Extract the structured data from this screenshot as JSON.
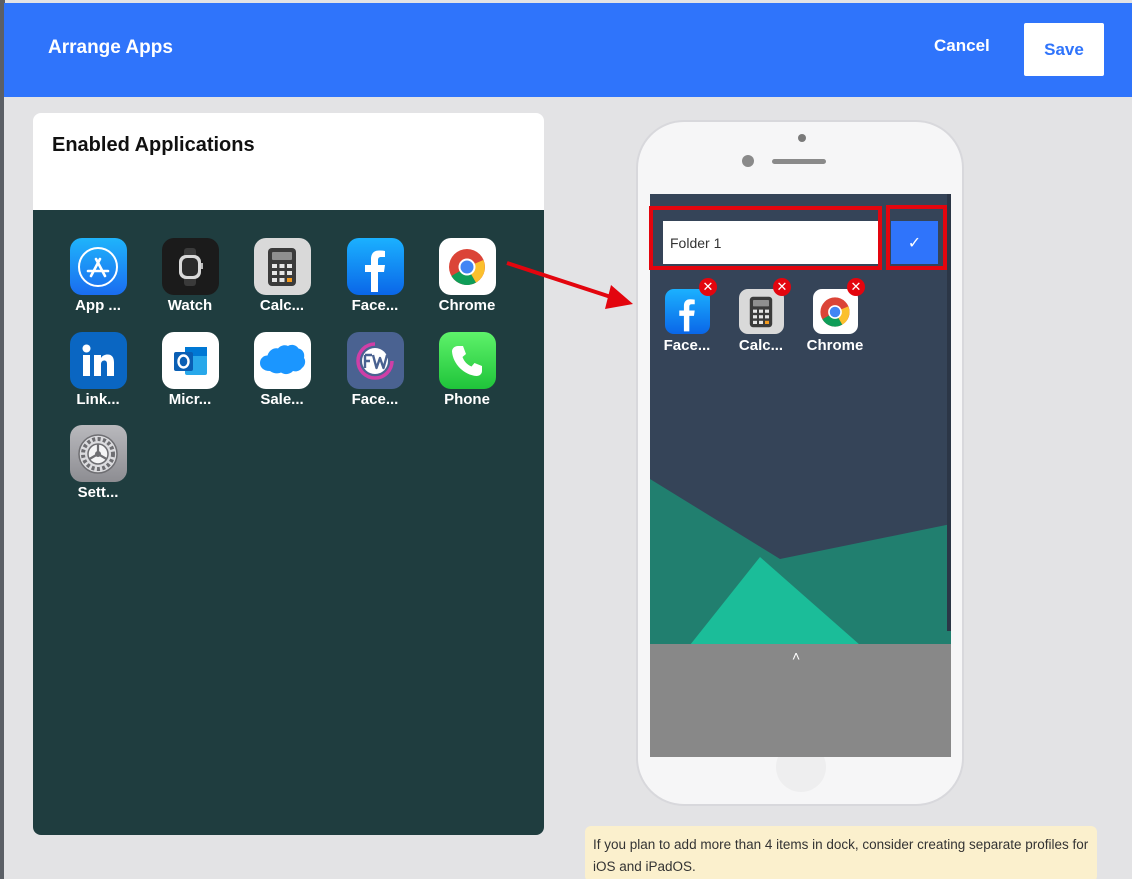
{
  "header": {
    "title": "Arrange Apps",
    "cancel_label": "Cancel",
    "save_label": "Save"
  },
  "panel": {
    "title": "Enabled Applications",
    "apps": [
      {
        "label": "App ...",
        "icon": "app-store-icon"
      },
      {
        "label": "Watch",
        "icon": "watch-icon"
      },
      {
        "label": "Calc...",
        "icon": "calculator-icon"
      },
      {
        "label": "Face...",
        "icon": "facebook-icon"
      },
      {
        "label": "Chrome",
        "icon": "chrome-icon"
      },
      {
        "label": "Link...",
        "icon": "linkedin-icon"
      },
      {
        "label": "Micr...",
        "icon": "outlook-icon"
      },
      {
        "label": "Sale...",
        "icon": "salesforce-icon"
      },
      {
        "label": "Face...",
        "icon": "facework-icon"
      },
      {
        "label": "Phone",
        "icon": "phone-icon"
      },
      {
        "label": "Sett...",
        "icon": "settings-icon"
      }
    ]
  },
  "folder": {
    "name_value": "Folder 1",
    "apps": [
      {
        "label": "Face...",
        "icon": "facebook-icon"
      },
      {
        "label": "Calc...",
        "icon": "calculator-icon"
      },
      {
        "label": "Chrome",
        "icon": "chrome-icon"
      }
    ],
    "remove_glyph": "✕",
    "confirm_glyph": "✓"
  },
  "dock": {
    "chevron": "˄"
  },
  "tip": {
    "text": "If you plan to add more than 4 items in dock, consider creating separate profiles for iOS and iPadOS."
  },
  "colors": {
    "primary": "#2f74fb",
    "highlight": "#e3050e",
    "grid_bg": "#1f3d3f",
    "screen_bg": "#354458",
    "tip_bg": "#fbf0cd"
  }
}
